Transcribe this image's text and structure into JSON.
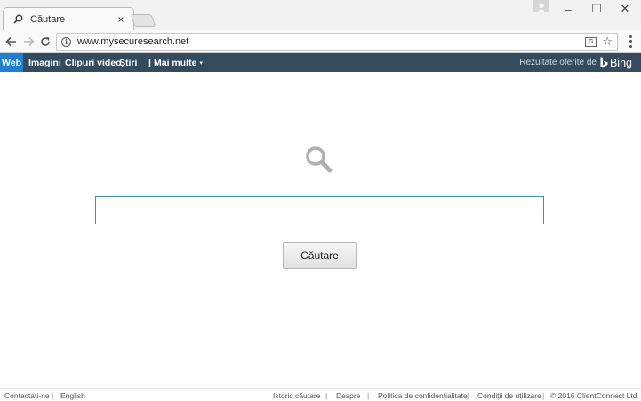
{
  "browser": {
    "tab_title": "Căutare",
    "tab_close": "×",
    "url": "www.mysecuresearch.net",
    "window_controls": {
      "minimize": "–",
      "maximize": "☐",
      "close": "✕"
    }
  },
  "bing_nav": {
    "items": [
      {
        "label": "Web",
        "active": true
      },
      {
        "label": "Imagini"
      },
      {
        "label": "Clipuri video"
      },
      {
        "label": "Ştiri"
      }
    ],
    "separator": "|",
    "more_label": "Mai multe",
    "more_caret": "▾",
    "powered_by": "Rezultate oferite de",
    "brand": "Bing"
  },
  "search": {
    "query": "",
    "button_label": "Căutare"
  },
  "footer": {
    "left": [
      "Contactaţi-ne",
      "English"
    ],
    "right": [
      "Istoric căutare",
      "Despre",
      "Politica de confidenţialitate",
      "Condiţii de utilizare",
      "© 2016 ClientConnect Ltd"
    ],
    "separator": "|"
  },
  "colors": {
    "nav_bar": "#334b5d",
    "nav_active": "#1c80d8",
    "input_border": "#3e8fd6"
  }
}
